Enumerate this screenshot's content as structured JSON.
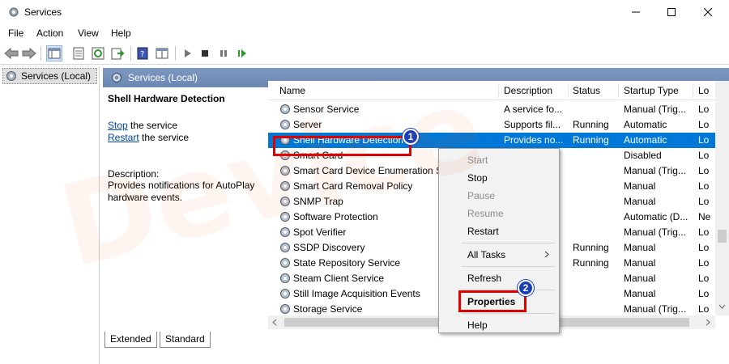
{
  "window": {
    "title": "Services"
  },
  "menu": [
    "File",
    "Action",
    "View",
    "Help"
  ],
  "tree": {
    "item": "Services (Local)"
  },
  "pane": {
    "header": "Services (Local)",
    "selected_name": "Shell Hardware Detection",
    "stop_link": "Stop",
    "stop_suffix": " the service",
    "restart_link": "Restart",
    "restart_suffix": " the service",
    "description_label": "Description:",
    "description_text": "Provides notifications for AutoPlay hardware events."
  },
  "columns": [
    "Name",
    "Description",
    "Status",
    "Startup Type",
    "Lo"
  ],
  "rows": [
    {
      "name": "Sensor Service",
      "description": "A service fo...",
      "status": "",
      "startup": "Manual (Trig...",
      "logon": "Lo"
    },
    {
      "name": "Server",
      "description": "Supports fil...",
      "status": "Running",
      "startup": "Automatic",
      "logon": "Lo"
    },
    {
      "name": "Shell Hardware Detection",
      "description": "Provides no...",
      "status": "Running",
      "startup": "Automatic",
      "logon": "Lo"
    },
    {
      "name": "Smart Card",
      "description": "",
      "status": "",
      "startup": "Disabled",
      "logon": "Lo"
    },
    {
      "name": "Smart Card Device Enumeration Se",
      "description": "",
      "status": "",
      "startup": "Manual (Trig...",
      "logon": "Lo"
    },
    {
      "name": "Smart Card Removal Policy",
      "description": "",
      "status": "",
      "startup": "Manual",
      "logon": "Lo"
    },
    {
      "name": "SNMP Trap",
      "description": "",
      "status": "",
      "startup": "Manual",
      "logon": "Lo"
    },
    {
      "name": "Software Protection",
      "description": "",
      "status": "",
      "startup": "Automatic (D...",
      "logon": "Ne"
    },
    {
      "name": "Spot Verifier",
      "description": "",
      "status": "",
      "startup": "Manual (Trig...",
      "logon": "Lo"
    },
    {
      "name": "SSDP Discovery",
      "description": "",
      "status": "Running",
      "startup": "Manual",
      "logon": "Lo"
    },
    {
      "name": "State Repository Service",
      "description": "",
      "status": "Running",
      "startup": "Manual",
      "logon": "Lo"
    },
    {
      "name": "Steam Client Service",
      "description": "",
      "status": "",
      "startup": "Manual",
      "logon": "Lo"
    },
    {
      "name": "Still Image Acquisition Events",
      "description": "",
      "status": "",
      "startup": "Manual",
      "logon": "Lo"
    },
    {
      "name": "Storage Service",
      "description": "",
      "status": "",
      "startup": "Manual (Trig...",
      "logon": "Lo"
    }
  ],
  "context_menu": {
    "start": "Start",
    "stop": "Stop",
    "pause": "Pause",
    "resume": "Resume",
    "restart": "Restart",
    "all_tasks": "All Tasks",
    "refresh": "Refresh",
    "properties": "Properties",
    "help": "Help"
  },
  "tabs": [
    "Extended",
    "Standard"
  ],
  "callouts": [
    "1",
    "2"
  ],
  "watermark": "Device",
  "colors": {
    "selection": "#0078d7",
    "header": "#7d97bf",
    "highlight_box": "#e10000",
    "badge": "#1a3fb5"
  }
}
